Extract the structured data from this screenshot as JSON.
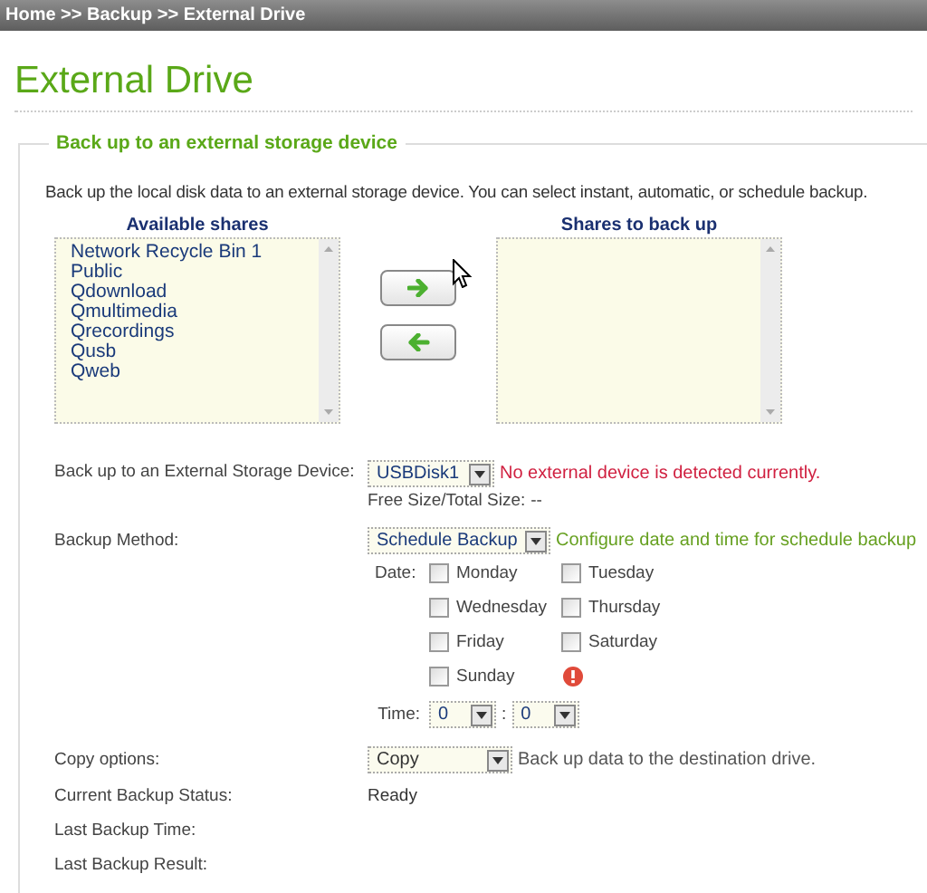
{
  "breadcrumb": "Home >> Backup >> External Drive",
  "page_title": "External Drive",
  "section": {
    "legend": "Back up to an external storage device",
    "description": "Back up the local disk data to an external storage device. You can select instant, automatic, or schedule backup.",
    "available_shares": {
      "label": "Available shares",
      "items": [
        "Network Recycle Bin 1",
        "Public",
        "Qdownload",
        "Qmultimedia",
        "Qrecordings",
        "Qusb",
        "Qweb"
      ]
    },
    "shares_to_back_up": {
      "label": "Shares to back up"
    },
    "transfer_buttons": [
      {
        "kind": "right"
      },
      {
        "kind": "left"
      }
    ]
  },
  "device": {
    "label": "Back up to an External Storage Device:",
    "value": "USBDisk1",
    "message": "No external device is detected currently.",
    "size_label": "Free Size/Total Size:",
    "size_value": "--"
  },
  "method": {
    "label": "Backup Method:",
    "value": "Schedule Backup",
    "hint": "Configure date and time for schedule backup"
  },
  "date": {
    "label": "Date:",
    "days": [
      {
        "label": "Monday",
        "checked": false
      },
      {
        "label": "Tuesday",
        "checked": false
      },
      {
        "label": "Wednesday",
        "checked": false
      },
      {
        "label": "Thursday",
        "checked": false
      },
      {
        "label": "Friday",
        "checked": false
      },
      {
        "label": "Saturday",
        "checked": false
      },
      {
        "label": "Sunday",
        "checked": false
      }
    ],
    "warning": true
  },
  "time": {
    "label": "Time:",
    "hour": "0",
    "separator": ":",
    "minute": "0"
  },
  "copy": {
    "label": "Copy options:",
    "value": "Copy",
    "hint": "Back up data to the destination drive."
  },
  "status_rows": [
    {
      "label": "Current Backup Status:",
      "value": "Ready"
    },
    {
      "label": "Last Backup Time:"
    },
    {
      "label": "Last Backup Result:"
    }
  ]
}
